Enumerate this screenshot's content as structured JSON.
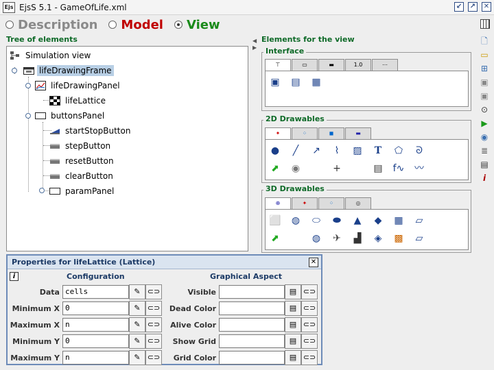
{
  "window": {
    "title": "EjsS 5.1 - GameOfLife.xml",
    "app_icon_text": "Ejs"
  },
  "modes": [
    {
      "label": "Description",
      "color": "#8a8a8a",
      "selected": false
    },
    {
      "label": "Model",
      "color": "#c00000",
      "selected": false
    },
    {
      "label": "View",
      "color": "#1a8a1a",
      "selected": true
    }
  ],
  "tree": {
    "header": "Tree of elements",
    "items": [
      {
        "label": "Simulation view"
      },
      {
        "label": "lifeDrawingFrame",
        "selected": true
      },
      {
        "label": "lifeDrawingPanel"
      },
      {
        "label": "lifeLattice"
      },
      {
        "label": "buttonsPanel"
      },
      {
        "label": "startStopButton"
      },
      {
        "label": "stepButton"
      },
      {
        "label": "resetButton"
      },
      {
        "label": "clearButton"
      },
      {
        "label": "paramPanel"
      }
    ]
  },
  "elements": {
    "header": "Elements for the view",
    "groups": [
      {
        "title": "Interface",
        "tabs": [
          "",
          "",
          "",
          "1.0",
          ""
        ]
      },
      {
        "title": "2D Drawables"
      },
      {
        "title": "3D Drawables"
      }
    ]
  },
  "properties": {
    "title": "Properties for lifeLattice (Lattice)",
    "info_icon": "i",
    "left_section": "Configuration",
    "right_section": "Graphical Aspect",
    "left_rows": [
      {
        "label": "Data",
        "value": "cells"
      },
      {
        "label": "Minimum X",
        "value": "0"
      },
      {
        "label": "Maximum X",
        "value": "n"
      },
      {
        "label": "Minimum Y",
        "value": "0"
      },
      {
        "label": "Maximum Y",
        "value": "n"
      }
    ],
    "right_rows": [
      {
        "label": "Visible",
        "value": ""
      },
      {
        "label": "Dead Color",
        "value": ""
      },
      {
        "label": "Alive Color",
        "value": ""
      },
      {
        "label": "Show Grid",
        "value": ""
      },
      {
        "label": "Grid Color",
        "value": ""
      }
    ]
  }
}
